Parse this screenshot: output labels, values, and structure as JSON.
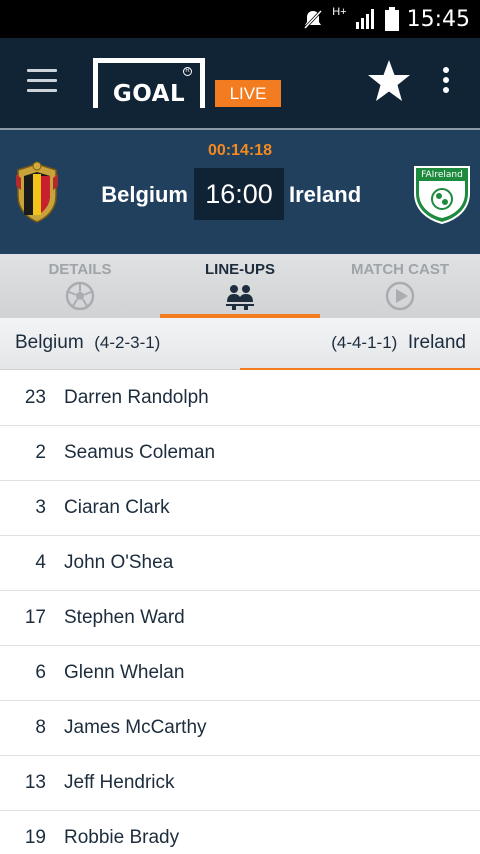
{
  "status_bar": {
    "network": "H+",
    "time": "15:45"
  },
  "app_bar": {
    "logo_text": "GOAL",
    "live_label": "LIVE"
  },
  "match": {
    "elapsed": "00:14:18",
    "home_team": "Belgium",
    "away_team": "Ireland",
    "score": "16:00"
  },
  "tabs": [
    {
      "label": "DETAILS",
      "icon": "soccer-ball-icon",
      "active": false
    },
    {
      "label": "LINE-UPS",
      "icon": "players-icon",
      "active": true
    },
    {
      "label": "MATCH CAST",
      "icon": "play-icon",
      "active": false
    }
  ],
  "lineup": {
    "home_team": "Belgium",
    "home_formation": "(4-2-3-1)",
    "away_formation": "(4-4-1-1)",
    "away_team": "Ireland",
    "players": [
      {
        "number": "23",
        "name": "Darren Randolph"
      },
      {
        "number": "2",
        "name": "Seamus Coleman"
      },
      {
        "number": "3",
        "name": "Ciaran Clark"
      },
      {
        "number": "4",
        "name": "John O'Shea"
      },
      {
        "number": "17",
        "name": "Stephen Ward"
      },
      {
        "number": "6",
        "name": "Glenn Whelan"
      },
      {
        "number": "8",
        "name": "James McCarthy"
      },
      {
        "number": "13",
        "name": "Jeff Hendrick"
      },
      {
        "number": "19",
        "name": "Robbie Brady"
      }
    ]
  },
  "colors": {
    "app_bar": "#112435",
    "match_header": "#21405e",
    "accent": "#f47c20"
  },
  "crests": {
    "home": "Belgium crest",
    "away": "FAI Ireland crest",
    "away_crest_text": "FAIreland"
  }
}
